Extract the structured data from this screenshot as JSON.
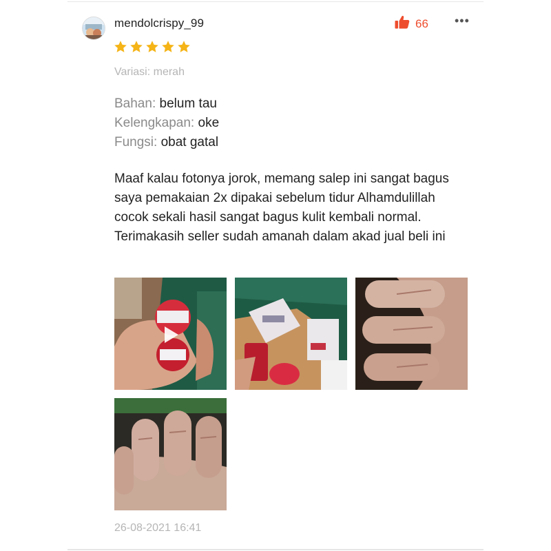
{
  "review": {
    "username": "mendolcrispy_99",
    "like_count": "66",
    "more_label": "•••",
    "rating": 5,
    "rating_max": 5,
    "variation": "Variasi: merah",
    "attributes": [
      {
        "key": "Bahan:",
        "value": "belum tau"
      },
      {
        "key": "Kelengkapan:",
        "value": "oke"
      },
      {
        "key": "Fungsi:",
        "value": "obat gatal"
      }
    ],
    "comment": "Maaf kalau fotonya jorok, memang salep ini sangat bagus saya pemakaian 2x dipakai sebelum tidur Alhamdulillah cocok sekali hasil sangat bagus kulit kembali normal. Terimakasih seller sudah amanah dalam akad jual beli ini",
    "media": [
      {
        "kind": "video",
        "subject": "hand holding red ointment jar"
      },
      {
        "kind": "image",
        "subject": "ointment jar and box packaging"
      },
      {
        "kind": "image",
        "subject": "toes skin close-up"
      },
      {
        "kind": "image",
        "subject": "toes skin close-up"
      }
    ],
    "timestamp": "26-08-2021 16:41"
  },
  "colors": {
    "accent": "#ee4d2d",
    "star": "#f5b417",
    "muted_text": "#b5b5b5",
    "label_text": "#8a8a8a"
  },
  "icons": {
    "like": "thumbs-up-icon",
    "more": "more-horizontal-icon",
    "play": "play-icon",
    "star": "star-icon"
  }
}
